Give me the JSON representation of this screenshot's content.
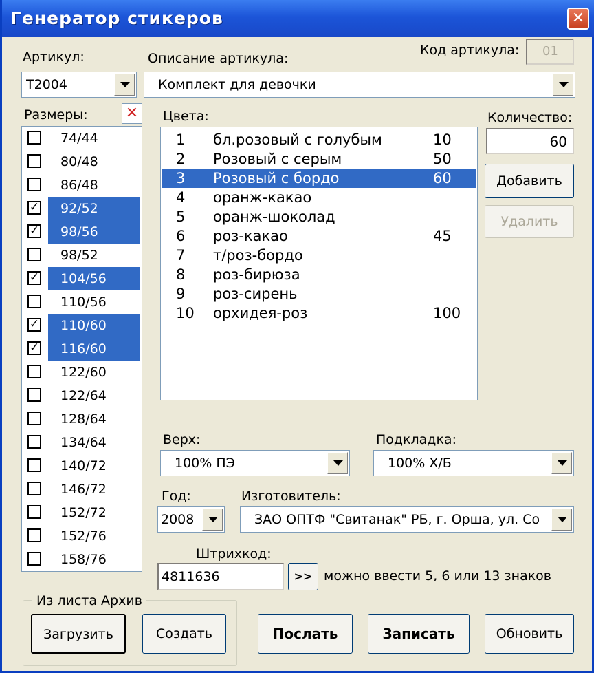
{
  "window": {
    "title": "Генератор стикеров",
    "close_glyph": "✕"
  },
  "article": {
    "label": "Артикул:",
    "value": "Т2004"
  },
  "description": {
    "label": "Описание артикула:",
    "value": "Комплект для девочки"
  },
  "article_code": {
    "label": "Код артикула:",
    "value": "01"
  },
  "sizes": {
    "label": "Размеры:",
    "clear_icon": "x-icon",
    "items": [
      {
        "label": "74/44",
        "checked": false,
        "selected": false
      },
      {
        "label": "80/48",
        "checked": false,
        "selected": false
      },
      {
        "label": "86/48",
        "checked": false,
        "selected": false
      },
      {
        "label": "92/52",
        "checked": true,
        "selected": true
      },
      {
        "label": "98/56",
        "checked": true,
        "selected": true
      },
      {
        "label": "98/52",
        "checked": false,
        "selected": false
      },
      {
        "label": "104/56",
        "checked": true,
        "selected": true
      },
      {
        "label": "110/56",
        "checked": false,
        "selected": false
      },
      {
        "label": "110/60",
        "checked": true,
        "selected": true
      },
      {
        "label": "116/60",
        "checked": true,
        "selected": true
      },
      {
        "label": "122/60",
        "checked": false,
        "selected": false
      },
      {
        "label": "122/64",
        "checked": false,
        "selected": false
      },
      {
        "label": "128/64",
        "checked": false,
        "selected": false
      },
      {
        "label": "134/64",
        "checked": false,
        "selected": false
      },
      {
        "label": "140/72",
        "checked": false,
        "selected": false
      },
      {
        "label": "146/72",
        "checked": false,
        "selected": false
      },
      {
        "label": "152/72",
        "checked": false,
        "selected": false
      },
      {
        "label": "152/76",
        "checked": false,
        "selected": false
      },
      {
        "label": "158/76",
        "checked": false,
        "selected": false
      }
    ]
  },
  "colors": {
    "label": "Цвета:",
    "items": [
      {
        "num": "1",
        "name": "бл.розовый с голубым",
        "qty": "10",
        "selected": false
      },
      {
        "num": "2",
        "name": "Розовый с серым",
        "qty": "50",
        "selected": false
      },
      {
        "num": "3",
        "name": "Розовый с бордо",
        "qty": "60",
        "selected": true
      },
      {
        "num": "4",
        "name": "оранж-какао",
        "qty": "",
        "selected": false
      },
      {
        "num": "5",
        "name": "оранж-шоколад",
        "qty": "",
        "selected": false
      },
      {
        "num": "6",
        "name": "роз-какао",
        "qty": "45",
        "selected": false
      },
      {
        "num": "7",
        "name": "т/роз-бордо",
        "qty": "",
        "selected": false
      },
      {
        "num": "8",
        "name": "роз-бирюза",
        "qty": "",
        "selected": false
      },
      {
        "num": "9",
        "name": "роз-сирень",
        "qty": "",
        "selected": false
      },
      {
        "num": "10",
        "name": "орхидея-роз",
        "qty": "100",
        "selected": false
      }
    ]
  },
  "quantity": {
    "label": "Количество:",
    "value": "60"
  },
  "buttons": {
    "add": "Добавить",
    "delete": "Удалить",
    "barcode_next": ">>",
    "load": "Загрузить",
    "create": "Создать",
    "send": "Послать",
    "save": "Записать",
    "refresh": "Обновить"
  },
  "top_material": {
    "label": "Верх:",
    "value": "100% ПЭ"
  },
  "lining": {
    "label": "Подкладка:",
    "value": "100% Х/Б"
  },
  "year": {
    "label": "Год:",
    "value": "2008"
  },
  "manufacturer": {
    "label": "Изготовитель:",
    "value": "ЗАО ОПТФ \"Свитанак\" РБ, г. Орша, ул. Со"
  },
  "barcode": {
    "label": "Штрихкод:",
    "value": "4811636",
    "hint": "можно ввести 5, 6 или 13 знаков"
  },
  "archive_group": {
    "label": "Из листа Архив"
  },
  "colors_theme": {
    "selection": "#316ac5",
    "titlebar": "#1c55d8",
    "window_bg": "#ece9d8"
  }
}
